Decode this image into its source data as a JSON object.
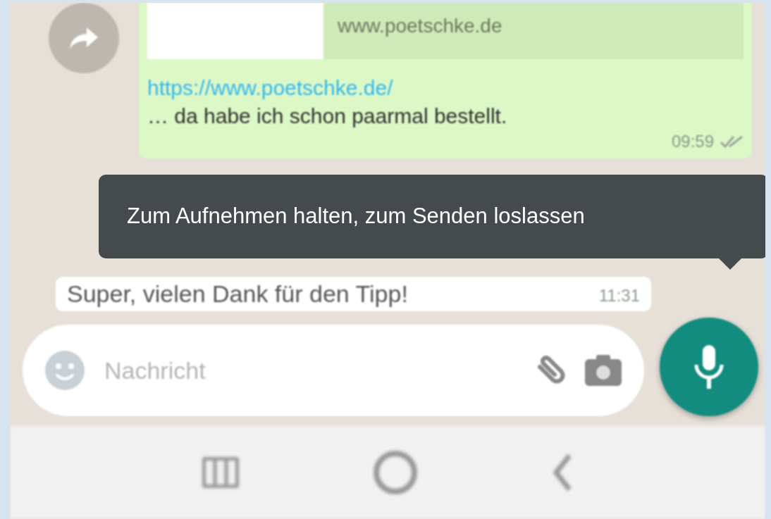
{
  "link_preview": {
    "domain": "www.poetschke.de"
  },
  "messages": [
    {
      "kind": "outgoing",
      "link": "https://www.poetschke.de/",
      "text": "… da habe ich schon paarmal bestellt.",
      "time": "09:59"
    },
    {
      "kind": "incoming",
      "text": "Super, vielen Dank für den Tipp!",
      "time": "11:31"
    }
  ],
  "composer": {
    "placeholder": "Nachricht"
  },
  "tooltip": {
    "text": "Zum Aufnehmen halten, zum Senden loslassen"
  }
}
